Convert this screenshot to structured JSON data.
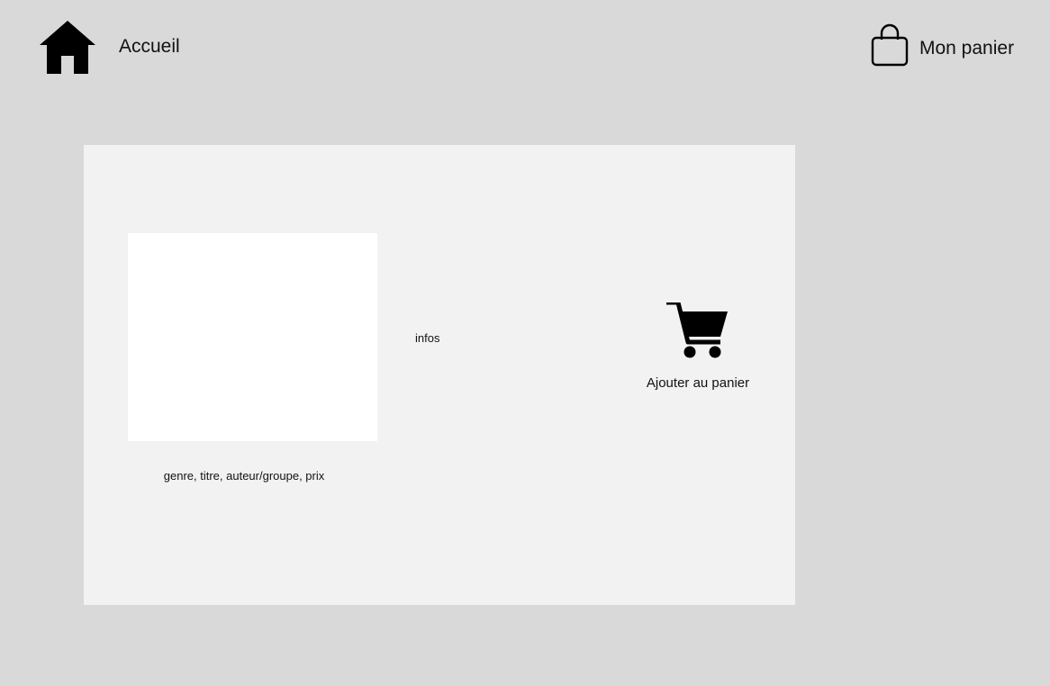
{
  "header": {
    "home": {
      "icon": "home-icon",
      "label": "Accueil"
    },
    "cart": {
      "icon": "shopping-bag-icon",
      "label": "Mon panier"
    }
  },
  "product": {
    "meta_text": "genre, titre, auteur/groupe, prix",
    "infos_text": "infos",
    "add_to_cart": {
      "icon": "shopping-cart-icon",
      "label": "Ajouter au panier"
    }
  },
  "colors": {
    "background": "#d9d9d9",
    "card": "#f2f2f2",
    "image_placeholder": "#ffffff",
    "icon": "#000000"
  }
}
